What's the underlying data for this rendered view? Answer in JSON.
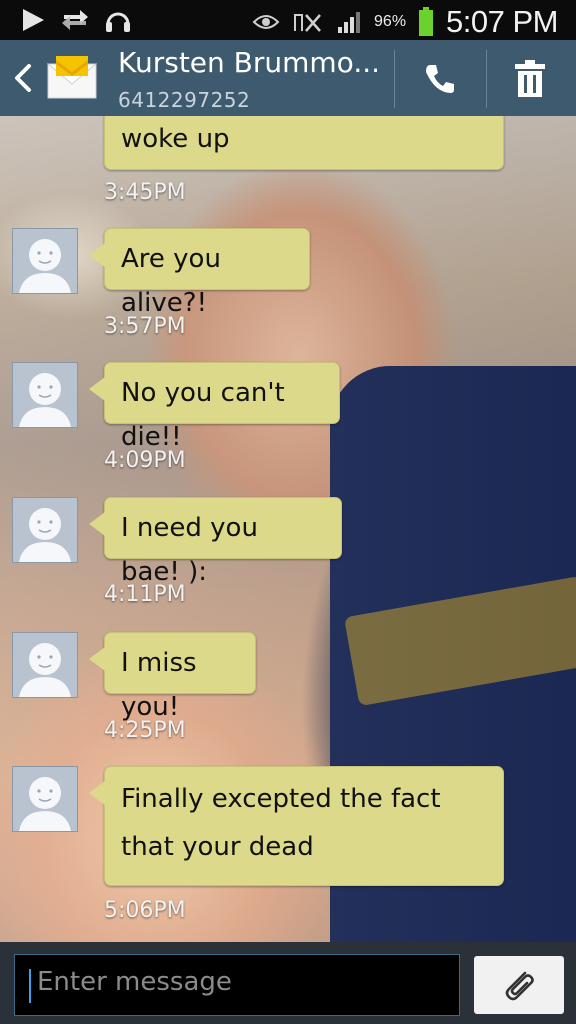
{
  "status_bar": {
    "battery_percent": "96%",
    "time": "5:07 PM",
    "icons": [
      "play-icon",
      "sync-icon",
      "headset-icon",
      "eye-icon",
      "no-signal-icon",
      "signal-icon",
      "battery-icon"
    ]
  },
  "header": {
    "contact_name": "Kursten Brummo...",
    "contact_number": "6412297252",
    "icons": [
      "back-icon",
      "message-envelope-icon",
      "phone-icon",
      "trash-icon"
    ]
  },
  "messages": [
    {
      "text": "woke up",
      "time": "3:45PM"
    },
    {
      "text": "Are you alive?!",
      "time": "3:57PM"
    },
    {
      "text": "No you can't die!!",
      "time": "4:09PM"
    },
    {
      "text": "I need you bae! ):",
      "time": "4:11PM"
    },
    {
      "text": "I miss you!",
      "time": "4:25PM"
    },
    {
      "text": "Finally excepted the fact",
      "text2": "that your dead",
      "time": "5:06PM"
    }
  ],
  "compose": {
    "placeholder": "Enter message",
    "attach_icon": "paperclip-icon"
  },
  "colors": {
    "header_bg": "#3e5a6f",
    "bubble_bg": "#ddd98a",
    "status_bar_bg": "#0b0b0b",
    "compose_bg": "#2b3138"
  }
}
